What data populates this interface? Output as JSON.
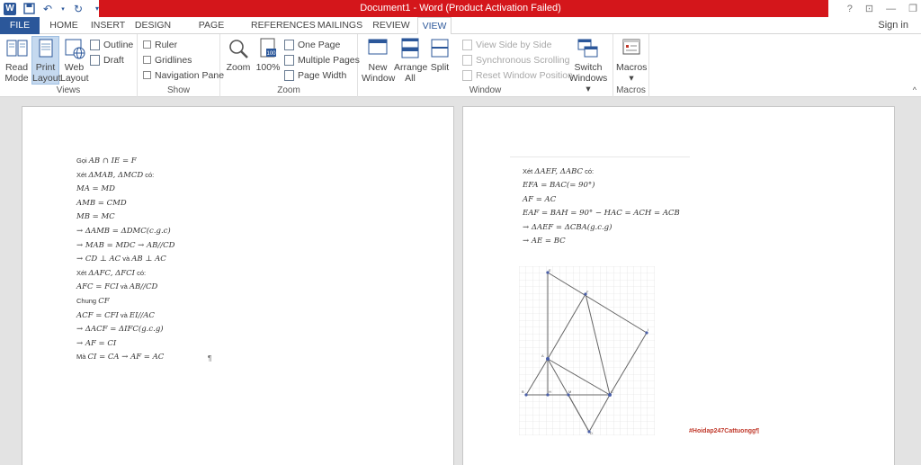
{
  "titlebar": {
    "title": "Document1 -  Word (Product Activation Failed)",
    "help": "?",
    "restore_ribbon": "⊡",
    "minimize": "—",
    "maximize": "❐"
  },
  "tabs": {
    "file": "FILE",
    "items": [
      "HOME",
      "INSERT",
      "DESIGN",
      "PAGE LAYOUT",
      "REFERENCES",
      "MAILINGS",
      "REVIEW",
      "VIEW"
    ],
    "signin": "Sign in"
  },
  "ribbon": {
    "views": {
      "label": "Views",
      "read_mode": [
        "Read",
        "Mode"
      ],
      "print_layout": [
        "Print",
        "Layout"
      ],
      "web_layout": [
        "Web",
        "Layout"
      ],
      "outline": "Outline",
      "draft": "Draft"
    },
    "show": {
      "label": "Show",
      "ruler": "Ruler",
      "gridlines": "Gridlines",
      "navigation_pane": "Navigation Pane"
    },
    "zoom": {
      "label": "Zoom",
      "zoom": "Zoom",
      "hundred": "100%",
      "one_page": "One Page",
      "multiple_pages": "Multiple Pages",
      "page_width": "Page Width"
    },
    "window": {
      "label": "Window",
      "new_window": [
        "New",
        "Window"
      ],
      "arrange_all": [
        "Arrange",
        "All"
      ],
      "split": "Split",
      "view_side_by_side": "View Side by Side",
      "sync_scrolling": "Synchronous Scrolling",
      "reset_window": "Reset Window Position",
      "switch_windows": [
        "Switch",
        "Windows ▾"
      ]
    },
    "macros": {
      "label": "Macros",
      "macros": "Macros",
      "dropdown": "▾"
    },
    "collapse": "^"
  },
  "page1": {
    "lines": [
      {
        "pre": "Gọi ",
        "math": "AB ∩ IE = F"
      },
      {
        "pre": "Xét ",
        "math": "ΔMAB, ΔMCD",
        "post": " có:"
      },
      {
        "pre": "",
        "math": "MA = MD"
      },
      {
        "pre": "",
        "math": "AMB = CMD"
      },
      {
        "pre": "",
        "math": "MB = MC"
      },
      {
        "pre": "",
        "math": "→ ΔAMB = ΔDMC(c.g.c)"
      },
      {
        "pre": "",
        "math": "→ MAB = MDC → AB//CD"
      },
      {
        "pre": "",
        "math": "→ CD ⊥ AC",
        "post": " và ",
        "math2": "AB ⊥ AC"
      },
      {
        "pre": "Xét ",
        "math": "ΔAFC, ΔFCI",
        "post": " có:"
      },
      {
        "pre": "",
        "math": "AFC = FCI",
        "post": " và ",
        "math2": "AB//CD"
      },
      {
        "pre": "Chung ",
        "math": "CF"
      },
      {
        "pre": "",
        "math": "ACF = CFI",
        "post": " và ",
        "math2": "EI//AC"
      },
      {
        "pre": "",
        "math": "→ ΔACF = ΔIFC(g.c.g)"
      },
      {
        "pre": "",
        "math": "→ AF = CI"
      },
      {
        "pre": "Mà ",
        "math": "CI = CA → AF = AC"
      }
    ],
    "pilcrow": "¶"
  },
  "page2": {
    "lines": [
      {
        "pre": "Xét ",
        "math": "ΔAEF, ΔABC",
        "post": " có:"
      },
      {
        "pre": "",
        "math": "EFA = BAC(= 90°)"
      },
      {
        "pre": "",
        "math": "AF = AC"
      },
      {
        "pre": "",
        "math": "EAF = BAH = 90° − HAC = ACH = ACB"
      },
      {
        "pre": "",
        "math": "→ ΔAEF = ΔCBA(g.c.g)"
      },
      {
        "pre": "",
        "math": "→ AE = BC"
      }
    ],
    "hashtag": "#Hoidap247Cattuongg¶",
    "figure_labels": [
      "E",
      "F",
      "I",
      "A",
      "H",
      "M",
      "D",
      "B",
      "C"
    ]
  },
  "colors": {
    "accent": "#2b579a",
    "titlebar_red": "#d4161b",
    "hashtag_red": "#c0392b"
  }
}
